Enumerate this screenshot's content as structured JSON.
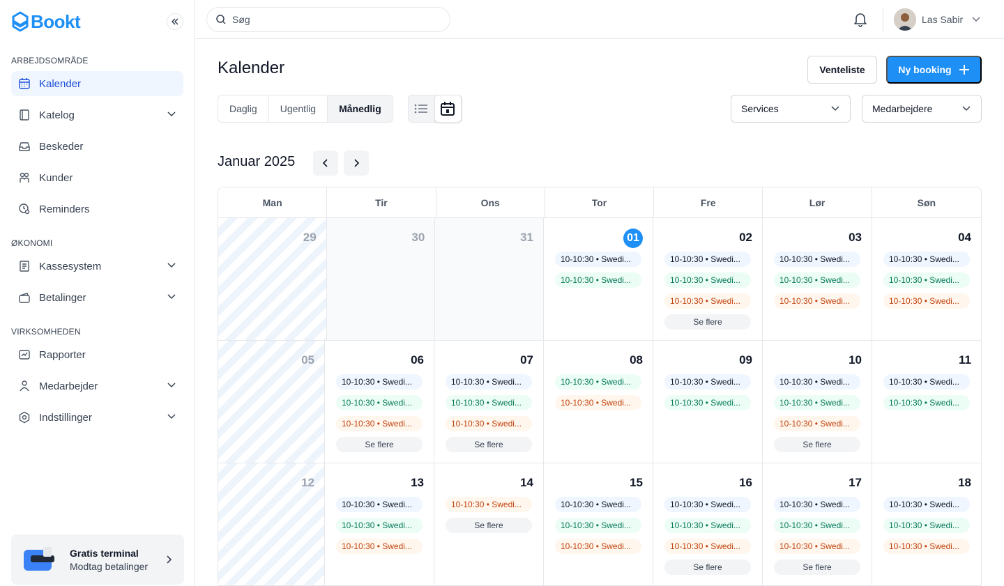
{
  "brand": {
    "name": "Bookt",
    "color": "#1d8ff5"
  },
  "sidebar": {
    "sections": [
      {
        "title": "ARBEJDSOMRÅDE",
        "items": [
          {
            "label": "Kalender",
            "icon": "calendar-icon",
            "active": true,
            "chevron": false
          },
          {
            "label": "Katelog",
            "icon": "book-icon",
            "chevron": true
          },
          {
            "label": "Beskeder",
            "icon": "inbox-icon",
            "chevron": false
          },
          {
            "label": "Kunder",
            "icon": "users-icon",
            "chevron": false
          },
          {
            "label": "Reminders",
            "icon": "clock-search-icon",
            "chevron": false
          }
        ]
      },
      {
        "title": "ØKONOMI",
        "items": [
          {
            "label": "Kassesystem",
            "icon": "receipt-icon",
            "chevron": true
          },
          {
            "label": "Betalinger",
            "icon": "wallet-icon",
            "chevron": true
          }
        ]
      },
      {
        "title": "VIRKSOMHEDEN",
        "items": [
          {
            "label": "Rapporter",
            "icon": "chart-icon",
            "chevron": false
          },
          {
            "label": "Medarbejder",
            "icon": "person-icon",
            "chevron": true
          },
          {
            "label": "Indstillinger",
            "icon": "gear-icon",
            "chevron": true
          }
        ]
      }
    ],
    "promo": {
      "title": "Gratis terminal",
      "subtitle": "Modtag betalinger"
    }
  },
  "topbar": {
    "search_placeholder": "Søg",
    "user_name": "Las Sabir"
  },
  "page": {
    "title": "Kalender",
    "waitlist_label": "Venteliste",
    "new_booking_label": "Ny booking",
    "views": [
      "Daglig",
      "Ugentlig",
      "Månedlig"
    ],
    "active_view": "Månedlig",
    "filter_services": "Services",
    "filter_staff": "Medarbejdere",
    "month_label": "Januar 2025"
  },
  "calendar": {
    "weekdays": [
      "Man",
      "Tir",
      "Ons",
      "Tor",
      "Fre",
      "Lør",
      "Søn"
    ],
    "more_label": "Se flere",
    "weeks": [
      [
        {
          "day": "29",
          "style": "striped",
          "events": [],
          "more": false
        },
        {
          "day": "30",
          "style": "muted",
          "events": [],
          "more": false
        },
        {
          "day": "31",
          "style": "muted",
          "events": [],
          "more": false
        },
        {
          "day": "01",
          "today": true,
          "events": [
            [
              "blue",
              "10-10:30 • Swedi..."
            ],
            [
              "green",
              "10-10:30 • Swedi..."
            ]
          ],
          "more": false
        },
        {
          "day": "02",
          "events": [
            [
              "blue",
              "10-10:30 • Swedi..."
            ],
            [
              "green",
              "10-10:30 • Swedi..."
            ],
            [
              "orange",
              "10-10:30 • Swedi..."
            ]
          ],
          "more": true
        },
        {
          "day": "03",
          "events": [
            [
              "blue",
              "10-10:30 • Swedi..."
            ],
            [
              "green",
              "10-10:30 • Swedi..."
            ],
            [
              "orange",
              "10-10:30 • Swedi..."
            ]
          ],
          "more": false
        },
        {
          "day": "04",
          "events": [
            [
              "blue",
              "10-10:30 • Swedi..."
            ],
            [
              "green",
              "10-10:30 • Swedi..."
            ],
            [
              "orange",
              "10-10:30 • Swedi..."
            ]
          ],
          "more": false
        }
      ],
      [
        {
          "day": "05",
          "style": "striped",
          "events": [],
          "more": false
        },
        {
          "day": "06",
          "events": [
            [
              "blue",
              "10-10:30 • Swedi..."
            ],
            [
              "green",
              "10-10:30 • Swedi..."
            ],
            [
              "orange",
              "10-10:30 • Swedi..."
            ]
          ],
          "more": true
        },
        {
          "day": "07",
          "events": [
            [
              "blue",
              "10-10:30 • Swedi..."
            ],
            [
              "green",
              "10-10:30 • Swedi..."
            ],
            [
              "orange",
              "10-10:30 • Swedi..."
            ]
          ],
          "more": true
        },
        {
          "day": "08",
          "events": [
            [
              "green",
              "10-10:30 • Swedi..."
            ],
            [
              "orange",
              "10-10:30 • Swedi..."
            ]
          ],
          "more": false
        },
        {
          "day": "09",
          "events": [
            [
              "blue",
              "10-10:30 • Swedi..."
            ],
            [
              "green",
              "10-10:30 • Swedi..."
            ]
          ],
          "more": false
        },
        {
          "day": "10",
          "events": [
            [
              "blue",
              "10-10:30 • Swedi..."
            ],
            [
              "green",
              "10-10:30 • Swedi..."
            ],
            [
              "orange",
              "10-10:30 • Swedi..."
            ]
          ],
          "more": true
        },
        {
          "day": "11",
          "events": [
            [
              "blue",
              "10-10:30 • Swedi..."
            ],
            [
              "green",
              "10-10:30 • Swedi..."
            ]
          ],
          "more": false
        }
      ],
      [
        {
          "day": "12",
          "style": "striped",
          "events": [],
          "more": false
        },
        {
          "day": "13",
          "events": [
            [
              "blue",
              "10-10:30 • Swedi..."
            ],
            [
              "green",
              "10-10:30 • Swedi..."
            ],
            [
              "orange",
              "10-10:30 • Swedi..."
            ]
          ],
          "more": false
        },
        {
          "day": "14",
          "events": [
            [
              "orange",
              "10-10:30 • Swedi..."
            ]
          ],
          "more": true
        },
        {
          "day": "15",
          "events": [
            [
              "blue",
              "10-10:30 • Swedi..."
            ],
            [
              "green",
              "10-10:30 • Swedi..."
            ],
            [
              "orange",
              "10-10:30 • Swedi..."
            ]
          ],
          "more": false
        },
        {
          "day": "16",
          "events": [
            [
              "blue",
              "10-10:30 • Swedi..."
            ],
            [
              "green",
              "10-10:30 • Swedi..."
            ],
            [
              "orange",
              "10-10:30 • Swedi..."
            ]
          ],
          "more": true
        },
        {
          "day": "17",
          "events": [
            [
              "blue",
              "10-10:30 • Swedi..."
            ],
            [
              "green",
              "10-10:30 • Swedi..."
            ],
            [
              "orange",
              "10-10:30 • Swedi..."
            ]
          ],
          "more": true
        },
        {
          "day": "18",
          "events": [
            [
              "blue",
              "10-10:30 • Swedi..."
            ],
            [
              "green",
              "10-10:30 • Swedi..."
            ],
            [
              "orange",
              "10-10:30 • Swedi..."
            ]
          ],
          "more": false
        }
      ]
    ]
  }
}
